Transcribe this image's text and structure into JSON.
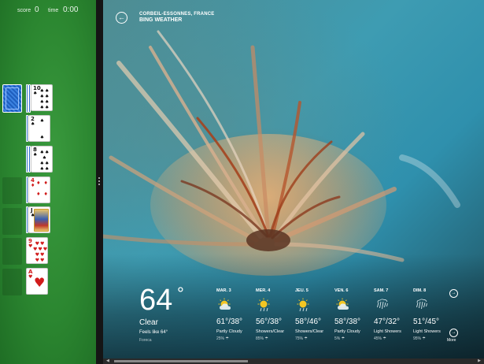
{
  "solitaire": {
    "score_label": "score",
    "score_value": "0",
    "time_label": "time",
    "time_value": "0:00",
    "cards": [
      {
        "rank": "10",
        "suit": "♠",
        "color": "black"
      },
      {
        "rank": "2",
        "suit": "♠",
        "color": "black"
      },
      {
        "rank": "8",
        "suit": "♠",
        "color": "black"
      },
      {
        "rank": "4",
        "suit": "♦",
        "color": "red"
      },
      {
        "rank": "J",
        "suit": "♠",
        "color": "black"
      },
      {
        "rank": "9",
        "suit": "♥",
        "color": "red"
      },
      {
        "rank": "A",
        "suit": "♥",
        "color": "red"
      }
    ]
  },
  "weather": {
    "location": "CORBEIL-ESSONNES, FRANCE",
    "app_name": "BING WEATHER",
    "current": {
      "temp": "64",
      "degree": "°",
      "condition": "Clear",
      "feels_like": "Feels like 64°",
      "source": "Foreca"
    },
    "forecast": [
      {
        "day": "MAR. 3",
        "range": "61°/38°",
        "desc": "Partly Cloudy",
        "precip": "25%",
        "icon": "partly-cloudy-icon"
      },
      {
        "day": "MER. 4",
        "range": "56°/38°",
        "desc": "Showers/Clear",
        "precip": "85%",
        "icon": "sun-showers-icon"
      },
      {
        "day": "JEU. 5",
        "range": "58°/46°",
        "desc": "Showers/Clear",
        "precip": "75%",
        "icon": "sun-showers-icon"
      },
      {
        "day": "VEN. 6",
        "range": "58°/38°",
        "desc": "Partly Cloudy",
        "precip": "5%",
        "icon": "partly-cloudy-icon"
      },
      {
        "day": "SAM. 7",
        "range": "47°/32°",
        "desc": "Light Showers",
        "precip": "45%",
        "icon": "rain-icon"
      },
      {
        "day": "DIM. 8",
        "range": "51°/45°",
        "desc": "Light Showers",
        "precip": "95%",
        "icon": "rain-icon"
      }
    ],
    "more_label": "More",
    "colors": {
      "sun": "#f3c623",
      "cloud": "#e6eef0",
      "rain": "#d7e6ea"
    }
  }
}
